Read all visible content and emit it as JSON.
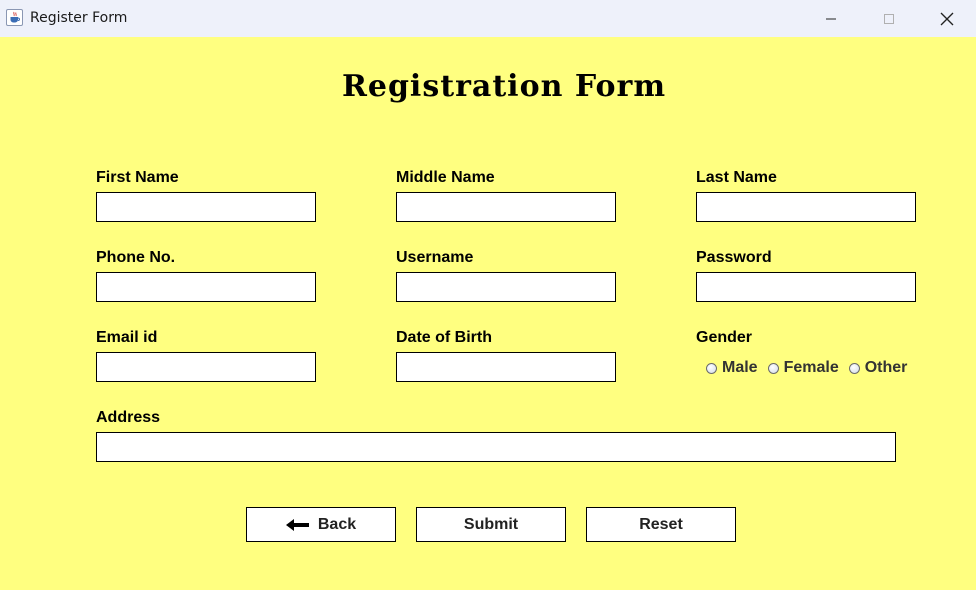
{
  "window": {
    "title": "Register Form",
    "app_icon": "java-cup-icon",
    "controls": [
      "minimize-icon",
      "maximize-icon",
      "close-icon"
    ]
  },
  "form": {
    "title": "Registration Form",
    "background_color": "#ffff80",
    "fields": {
      "first_name": {
        "label": "First Name",
        "value": ""
      },
      "middle_name": {
        "label": "Middle Name",
        "value": ""
      },
      "last_name": {
        "label": "Last Name",
        "value": ""
      },
      "phone": {
        "label": "Phone No.",
        "value": ""
      },
      "username": {
        "label": "Username",
        "value": ""
      },
      "password": {
        "label": "Password",
        "value": ""
      },
      "email": {
        "label": "Email id",
        "value": ""
      },
      "dob": {
        "label": "Date of Birth",
        "value": ""
      },
      "address": {
        "label": "Address",
        "value": ""
      }
    },
    "gender": {
      "label": "Gender",
      "options": [
        "Male",
        "Female",
        "Other"
      ],
      "selected": null
    },
    "buttons": {
      "back": "Back",
      "back_icon": "left-arrow-icon",
      "submit": "Submit",
      "reset": "Reset"
    }
  }
}
